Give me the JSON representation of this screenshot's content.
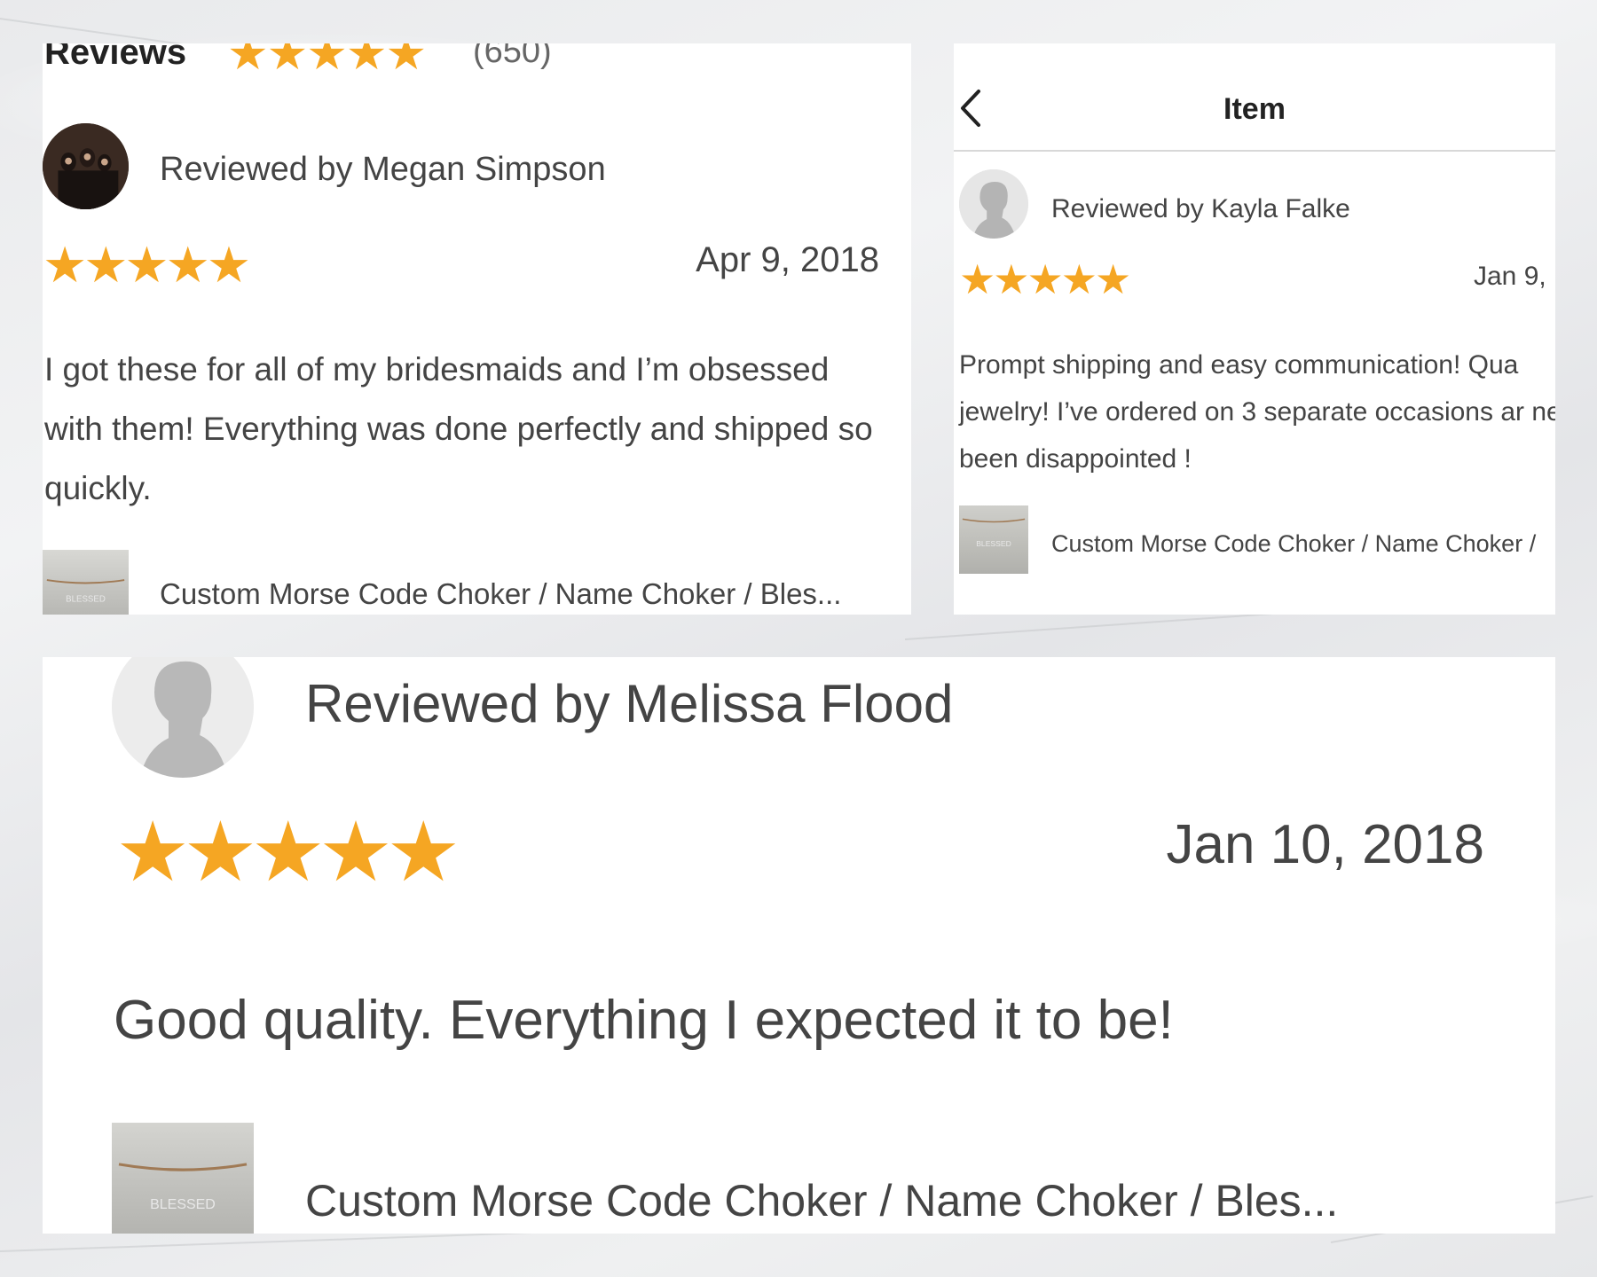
{
  "colors": {
    "star": "#f5a623",
    "text": "#444444",
    "card": "#ffffff"
  },
  "card1": {
    "reviews_title": "Reviews",
    "review_count": "(650)",
    "reviewer": "Reviewed by Megan Simpson",
    "rating_stars": 5,
    "date": "Apr 9, 2018",
    "text": "I got these for all of my bridesmaids and I’m obsessed with them! Everything was done perfectly and shipped so quickly.",
    "product": "Custom Morse Code Choker / Name Choker / Bles..."
  },
  "card2": {
    "title": "Item",
    "back_icon": "chevron-left-icon",
    "reviewer": "Reviewed by Kayla Falke",
    "rating_stars": 5,
    "date": "Jan 9,",
    "text": "Prompt shipping and easy communication! Qua jewelry! I’ve ordered on 3 separate occasions ar never been disappointed !",
    "product": "Custom Morse Code Choker / Name Choker /"
  },
  "card3": {
    "reviewer": "Reviewed by Melissa Flood",
    "rating_stars": 5,
    "date": "Jan 10, 2018",
    "text": "Good quality. Everything I expected it to be!",
    "product": "Custom Morse Code Choker / Name Choker / Bles..."
  }
}
